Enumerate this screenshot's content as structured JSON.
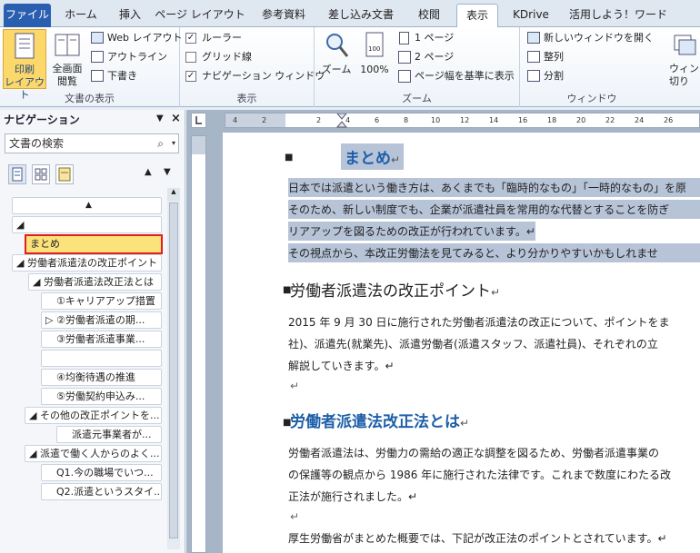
{
  "tabs": [
    "ファイル",
    "ホーム",
    "挿入",
    "ページ レイアウト",
    "参考資料",
    "差し込み文書",
    "校閲",
    "表示",
    "KDrive",
    "活用しよう！ワード"
  ],
  "ribbon": {
    "g1": {
      "label": "文書の表示",
      "print_layout": "印刷\nレイアウト",
      "full_screen": "全画面\n閲覧",
      "web_layout": "Web レイアウト",
      "outline": "アウトライン",
      "draft": "下書き"
    },
    "g2": {
      "label": "表示",
      "ruler": "ルーラー",
      "gridlines": "グリッド線",
      "nav_pane": "ナビゲーション ウィンドウ",
      "ruler_checked": "✓",
      "nav_checked": "✓"
    },
    "g3": {
      "label": "ズーム",
      "zoom": "ズーム",
      "hundred": "100%",
      "one_page": "1 ページ",
      "two_pages": "2 ページ",
      "page_width": "ページ幅を基準に表示"
    },
    "g4": {
      "label": "ウィンドウ",
      "new_window": "新しいウィンドウを開く",
      "arrange": "整列",
      "split": "分割",
      "switch": "ウィン\n切り"
    }
  },
  "nav": {
    "title": "ナビゲーション",
    "search_placeholder": "文書の検索",
    "items": [
      "",
      "まとめ",
      "労働者派遣法の改正ポイント",
      "労働者派遣法改正法とは",
      "①キャリアアップ措置",
      "②労働者派遣の期...",
      "③労働者派遣事業...",
      "",
      "④均衡待遇の推進",
      "⑤労働契約申込み...",
      "その他の改正ポイントを...",
      "派遣元事業者が...",
      "派遣で働く人からのよく...",
      "Q1.今の職場でいつ...",
      "Q2.派遣というスタイ..."
    ]
  },
  "ruler": {
    "ticks": [
      "4",
      "2",
      "2",
      "4",
      "6",
      "8",
      "10",
      "12",
      "14",
      "16",
      "18",
      "20",
      "22",
      "24",
      "26"
    ]
  },
  "doc": {
    "heading1": "まとめ",
    "p1": [
      "日本では派遣という働き方は、あくまでも「臨時的なもの」「一時的なもの」を原",
      "そのため、新しい制度でも、企業が派遣社員を常用的な代替とすることを防ぎ",
      "リアアップを図るための改正が行われています。",
      "その視点から、本改正労働法を見てみると、より分かりやすいかもしれませ"
    ],
    "heading2": "労働者派遣法の改正ポイント",
    "p2": [
      "2015 年 9 月 30 日に施行された労働者派遣法の改正について、ポイントをま",
      "社)、派遣先(就業先)、派遣労働者(派遣スタッフ、派遣社員)、それぞれの立",
      "解説していきます。"
    ],
    "heading3": "労働者派遣法改正法とは",
    "p3": [
      "労働者派遣法は、労働力の需給の適正な調整を図るため、労働者派遣事業の",
      "の保護等の観点から 1986 年に施行された法律です。これまで数度にわたる改",
      "正法が施行されました。"
    ],
    "p4": "厚生労働省がまとめた概要では、下記が改正法のポイントとされています。",
    "mark": "↵"
  }
}
